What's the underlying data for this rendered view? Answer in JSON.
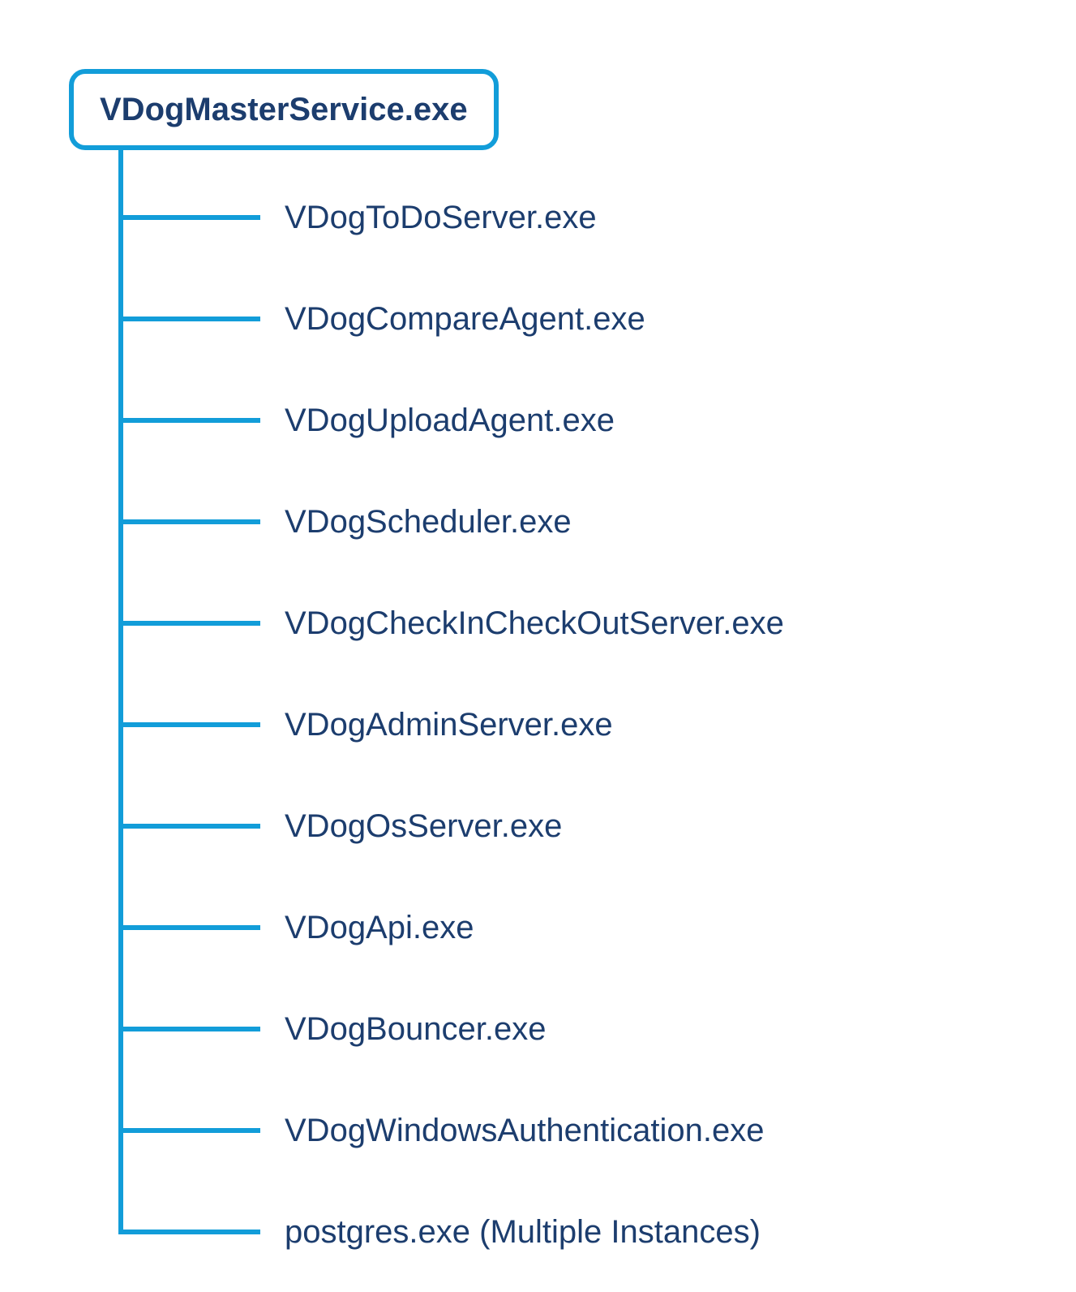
{
  "root": {
    "label": "VDogMasterService.exe"
  },
  "children": [
    {
      "label": "VDogToDoServer.exe"
    },
    {
      "label": "VDogCompareAgent.exe"
    },
    {
      "label": "VDogUploadAgent.exe"
    },
    {
      "label": "VDogScheduler.exe"
    },
    {
      "label": "VDogCheckInCheckOutServer.exe"
    },
    {
      "label": "VDogAdminServer.exe"
    },
    {
      "label": "VDogOsServer.exe"
    },
    {
      "label": "VDogApi.exe"
    },
    {
      "label": "VDogBouncer.exe"
    },
    {
      "label": "VDogWindowsAuthentication.exe"
    },
    {
      "label": "postgres.exe (Multiple Instances)"
    }
  ],
  "colors": {
    "line": "#129DD9",
    "text": "#1C3D6E"
  }
}
